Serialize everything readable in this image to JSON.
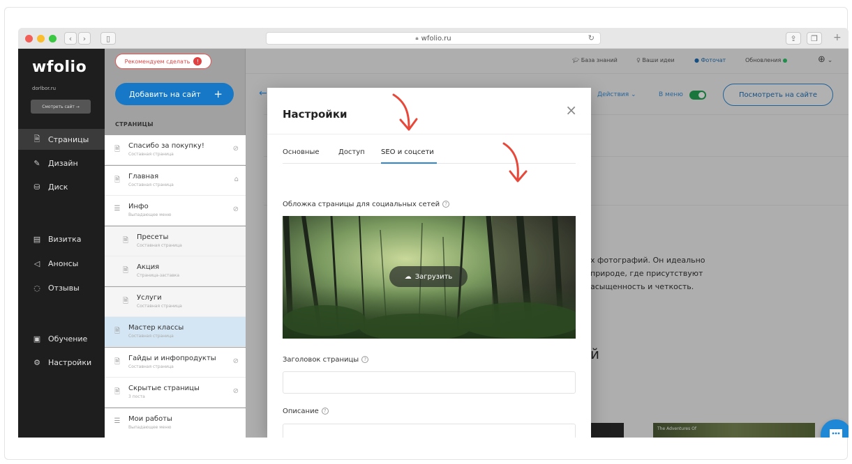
{
  "browser": {
    "url": "wfolio.ru",
    "reload_icon": "refresh-icon"
  },
  "sidebar": {
    "logo": "wfolio",
    "domain": "dorlbor.ru",
    "view_site": "Смотреть сайт →",
    "items": [
      {
        "label": "Страницы",
        "icon": "page-icon",
        "active": true
      },
      {
        "label": "Дизайн",
        "icon": "brush-icon",
        "active": false
      },
      {
        "label": "Диск",
        "icon": "disk-icon",
        "active": false
      },
      {
        "label": "Визитка",
        "icon": "card-icon",
        "active": false
      },
      {
        "label": "Анонсы",
        "icon": "megaphone-icon",
        "active": false
      },
      {
        "label": "Отзывы",
        "icon": "chat-icon",
        "active": false
      },
      {
        "label": "Обучение",
        "icon": "book-icon",
        "active": false
      },
      {
        "label": "Настройки",
        "icon": "gear-icon",
        "active": false
      }
    ]
  },
  "pages_panel": {
    "recommend": "Рекомендуем сделать",
    "recommend_badge": "!",
    "add_button": "Добавить на сайт",
    "add_plus": "+",
    "heading": "СТРАНИЦЫ",
    "rows": [
      {
        "title": "Спасибо за покупку!",
        "sub": "Составная страница",
        "right": "⊘",
        "level": 0
      },
      {
        "title": "Главная",
        "sub": "Составная страница",
        "right": "⌂",
        "level": 0
      },
      {
        "title": "Инфо",
        "sub": "Выпадающее меню",
        "right": "⊘",
        "level": 0
      },
      {
        "title": "Пресеты",
        "sub": "Составная страница",
        "right": "",
        "level": 1
      },
      {
        "title": "Акция",
        "sub": "Страница-заставка",
        "right": "",
        "level": 1
      },
      {
        "title": "Услуги",
        "sub": "Составная страница",
        "right": "",
        "level": 1
      },
      {
        "title": "Мастер классы",
        "sub": "Составная страница",
        "right": "",
        "level": 0,
        "selected": true
      },
      {
        "title": "Гайды и инфопродукты",
        "sub": "Составная страница",
        "right": "⊘",
        "level": 0
      },
      {
        "title": "Скрытые страницы",
        "sub": "3 поста",
        "right": "⊘",
        "level": 0
      },
      {
        "title": "Мои работы",
        "sub": "Выпадающее меню",
        "right": "",
        "level": 0
      }
    ]
  },
  "topbar": {
    "knowledge": "База знаний",
    "ideas": "Ваши идеи",
    "photochat": "Фоточат",
    "updates": "Обновления"
  },
  "page_header": {
    "actions": "Действия ⌄",
    "in_menu": "В меню",
    "view_button": "Посмотреть на сайте"
  },
  "page_body": {
    "lines": [
      "х фотографий. Он идеально",
      "природе, где присутствуют",
      "асыщенность и четкость."
    ],
    "partial_heading": "й",
    "thumb_caption": "The Adventures Of"
  },
  "modal": {
    "title": "Настройки",
    "close": "×",
    "tabs": [
      {
        "label": "Основные",
        "active": false
      },
      {
        "label": "Доступ",
        "active": false
      },
      {
        "label": "SEO и соцсети",
        "active": true
      }
    ],
    "cover_label": "Обложка страницы для социальных сетей",
    "upload_button": "Загрузить",
    "title_label": "Заголовок страницы",
    "title_value": "",
    "description_label": "Описание",
    "description_value": ""
  },
  "colors": {
    "accent": "#1678c6",
    "sidebar_bg": "#1e1e1e",
    "arrow": "#e8483a",
    "toggle_on": "#23a455"
  }
}
